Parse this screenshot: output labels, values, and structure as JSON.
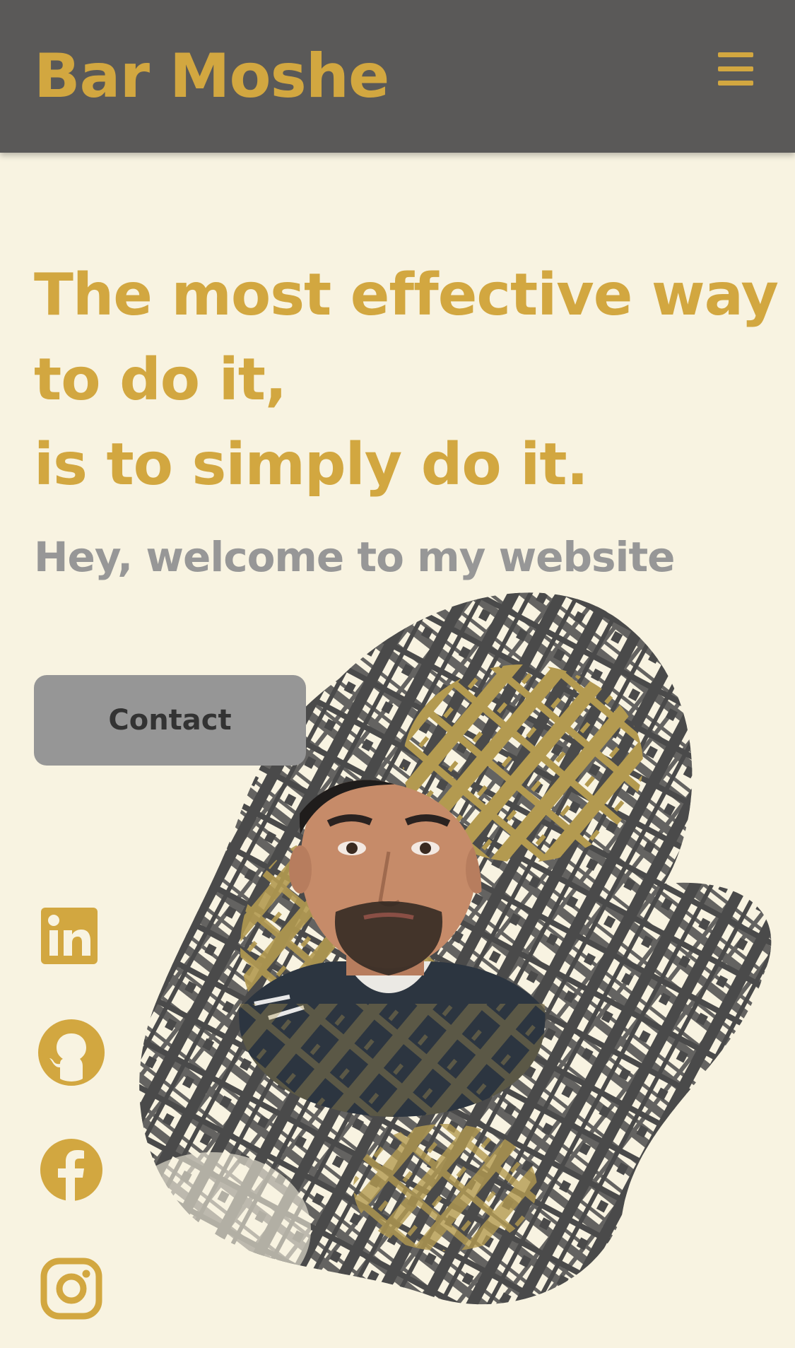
{
  "header": {
    "brand": "Bar Moshe",
    "menu_icon": "hamburger-menu-icon"
  },
  "hero": {
    "title_lines": [
      "The most effective way",
      "to do it,",
      "is to simply do it."
    ],
    "subtitle": "Hey, welcome to my website",
    "contact_label": "Contact"
  },
  "social": {
    "items": [
      {
        "name": "linkedin",
        "icon": "linkedin-icon"
      },
      {
        "name": "github",
        "icon": "github-icon"
      },
      {
        "name": "facebook",
        "icon": "facebook-icon"
      },
      {
        "name": "instagram",
        "icon": "instagram-icon"
      }
    ]
  },
  "colors": {
    "accent": "#d2a740",
    "header_bg": "#5a5958",
    "page_bg": "#f8f3e1",
    "subtitle": "#979797",
    "button_bg": "#969696",
    "button_text": "#333333",
    "art_dark": "#4a4a4a",
    "art_gold": "#b39a50"
  }
}
